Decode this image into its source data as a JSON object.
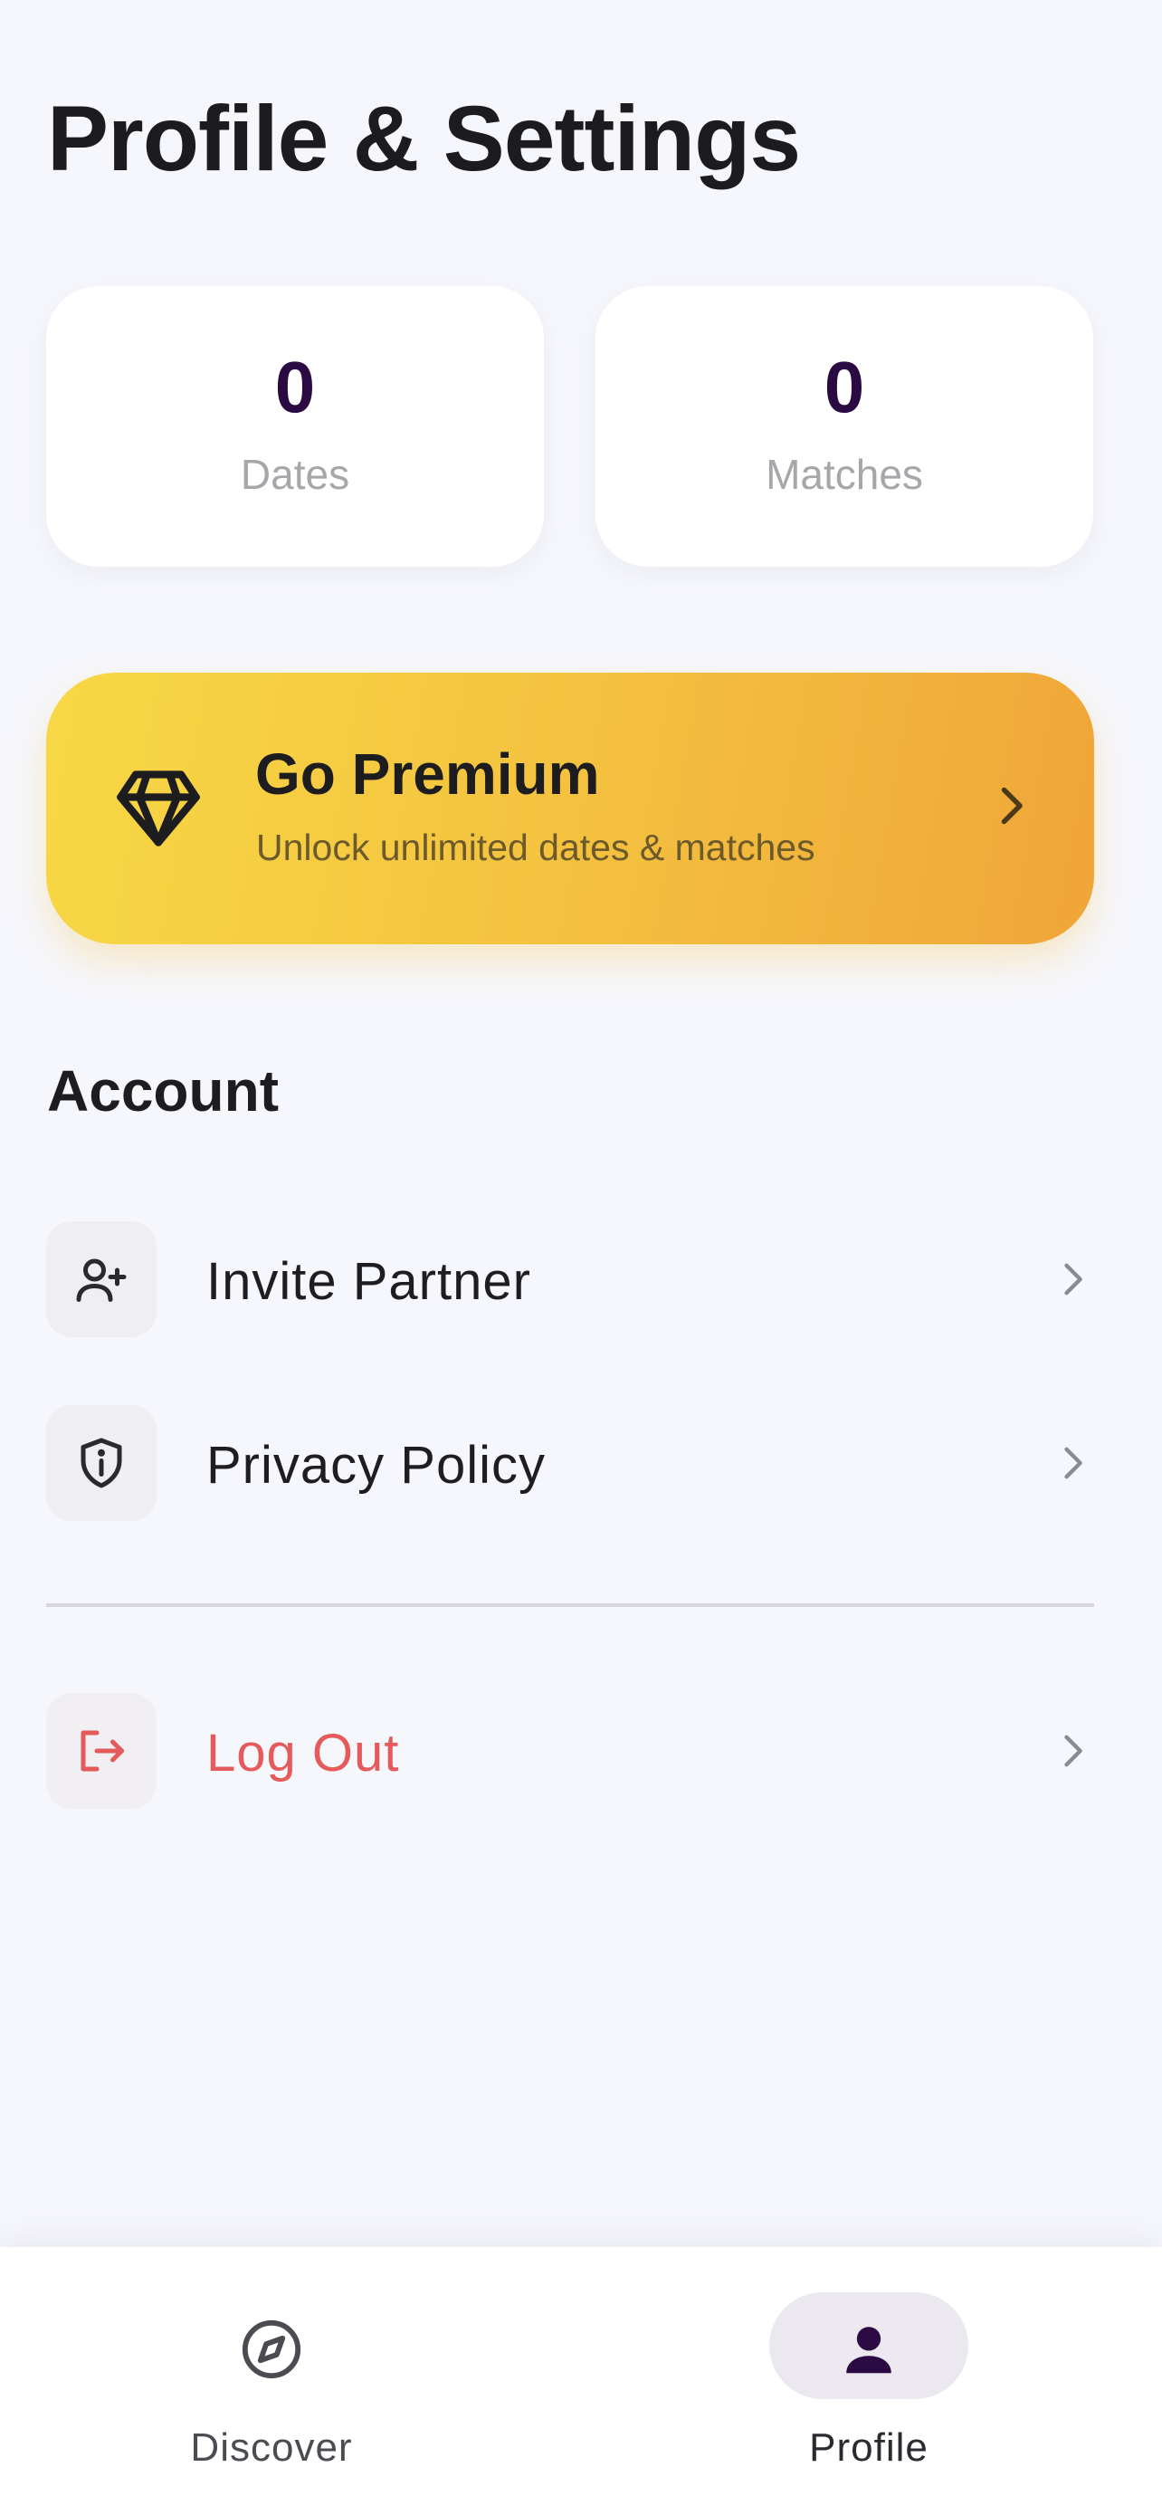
{
  "page": {
    "title": "Profile & Settings"
  },
  "stats": [
    {
      "value": "0",
      "label": "Dates"
    },
    {
      "value": "0",
      "label": "Matches"
    }
  ],
  "premium": {
    "title": "Go Premium",
    "subtitle": "Unlock unlimited dates & matches",
    "icon": "diamond-icon"
  },
  "account": {
    "heading": "Account",
    "items": [
      {
        "label": "Invite Partner",
        "icon": "user-plus-icon"
      },
      {
        "label": "Privacy Policy",
        "icon": "shield-info-icon"
      }
    ]
  },
  "logout": {
    "label": "Log Out",
    "icon": "logout-icon",
    "color": "#e55a5a"
  },
  "nav": {
    "items": [
      {
        "label": "Discover",
        "icon": "compass-icon",
        "active": false
      },
      {
        "label": "Profile",
        "icon": "person-icon",
        "active": true
      }
    ]
  },
  "colors": {
    "background": "#f6f7fc",
    "accent_dark": "#2b0a44",
    "premium_gradient_start": "#f7d845",
    "premium_gradient_end": "#f0a538",
    "danger": "#e55a5a"
  }
}
